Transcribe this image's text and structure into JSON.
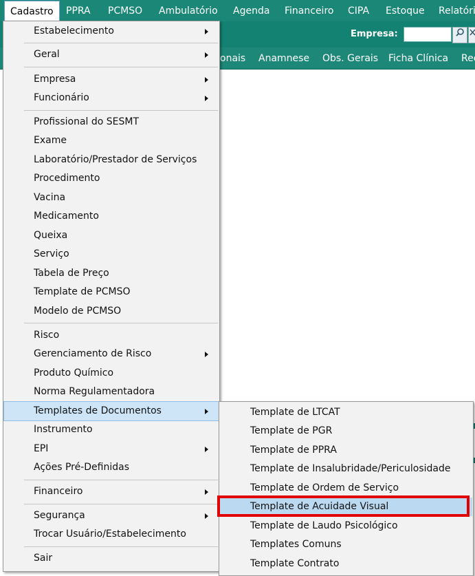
{
  "menubar": {
    "items": [
      "Cadastro",
      "PPRA",
      "PCMSO",
      "Ambulatório",
      "Agenda",
      "Financeiro",
      "CIPA",
      "Estoque",
      "Relatório"
    ]
  },
  "toolbar": {
    "empresa_label": "Empresa:",
    "empresa_value": "",
    "search_icon": "search-icon",
    "clear_icon": "x-icon"
  },
  "tabs": [
    "onais",
    "Anamnese",
    "Obs. Gerais",
    "Ficha Clínica",
    "Rec"
  ],
  "menu": {
    "items": [
      "Estabelecimento",
      "Geral",
      "Empresa",
      "Funcionário",
      "Profissional do SESMT",
      "Exame",
      "Laboratório/Prestador de Serviços",
      "Procedimento",
      "Vacina",
      "Medicamento",
      "Queixa",
      "Serviço",
      "Tabela de Preço",
      "Template de PCMSO",
      "Modelo de PCMSO",
      "Risco",
      "Gerenciamento de Risco",
      "Produto Químico",
      "Norma Regulamentadora",
      "Templates de Documentos",
      "Instrumento",
      "EPI",
      "Ações Pré-Definidas",
      "Financeiro",
      "Segurança",
      "Trocar Usuário/Estabelecimento",
      "Sair"
    ]
  },
  "submenu": {
    "items": [
      "Template de LTCAT",
      "Template de PGR",
      "Template de PPRA",
      "Template de Insalubridade/Periculosidade",
      "Template de Ordem de Serviço",
      "Template de Acuidade Visual",
      "Template de Laudo Psicológico",
      "Templates Comuns",
      "Template Contrato"
    ]
  },
  "colors": {
    "app_green": "#1a8777",
    "highlight": "#cde5f7",
    "annotation_red": "#e00000"
  }
}
